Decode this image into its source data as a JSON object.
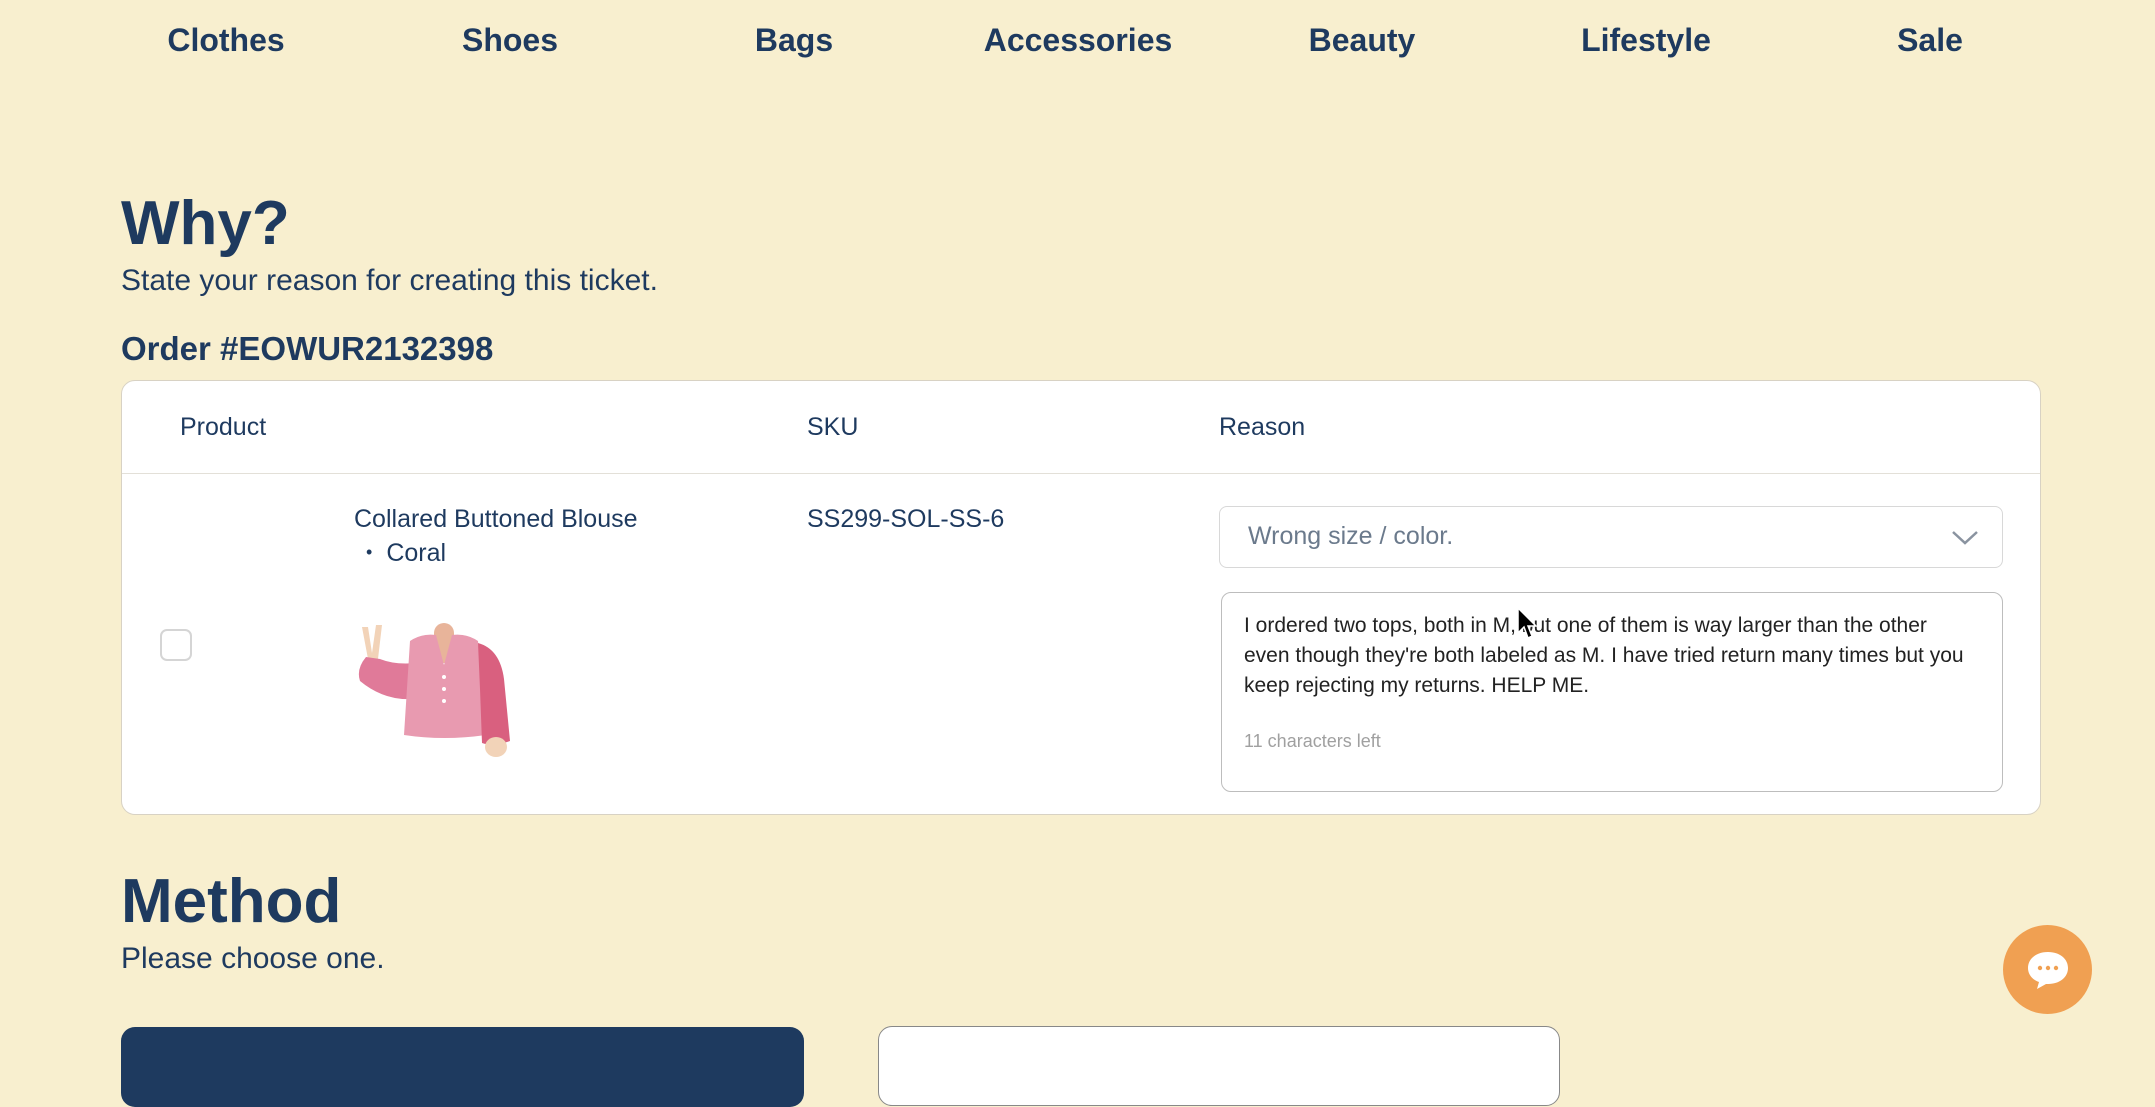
{
  "nav": {
    "items": [
      "Clothes",
      "Shoes",
      "Bags",
      "Accessories",
      "Beauty",
      "Lifestyle",
      "Sale"
    ]
  },
  "why": {
    "title": "Why?",
    "subtitle": "State your reason for creating this ticket."
  },
  "order": {
    "title": "Order #EOWUR2132398",
    "columns": {
      "product": "Product",
      "sku": "SKU",
      "reason": "Reason"
    },
    "item": {
      "name": "Collared Buttoned Blouse",
      "variant": "Coral",
      "sku": "SS299-SOL-SS-6",
      "reason_selected": "Wrong size / color.",
      "reason_text": "I ordered two tops, both in M, but one of them is way larger than the other even though they're both labeled as M. I have tried return many times but you keep rejecting my returns. HELP ME.",
      "chars_left": "11 characters left"
    }
  },
  "method": {
    "title": "Method",
    "subtitle": "Please choose one."
  },
  "colors": {
    "background": "#f8efcf",
    "primary": "#1e3a5f",
    "chat": "#f0a052"
  }
}
